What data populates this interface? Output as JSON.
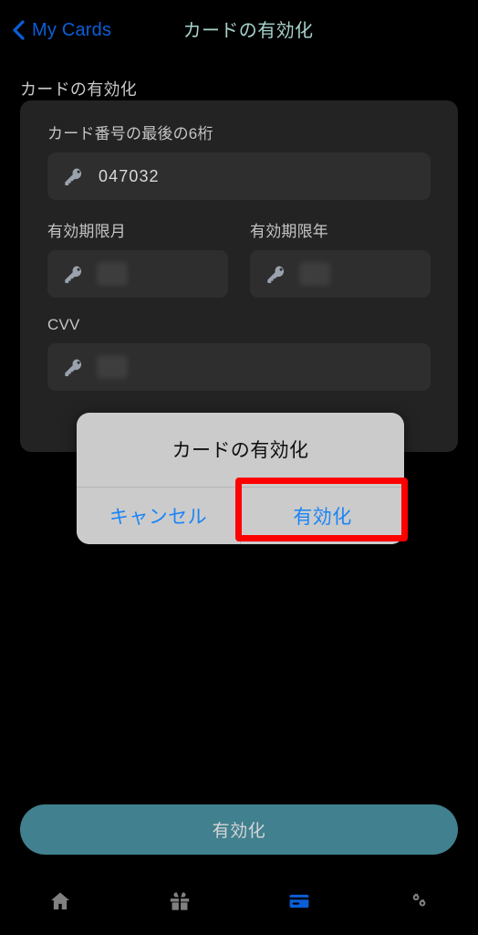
{
  "header": {
    "back_label": "My Cards",
    "back_icon": "chevron-left-icon",
    "title": "カードの有効化",
    "back_color": "#0a5fd8",
    "title_color": "#a6d2cc"
  },
  "section": {
    "heading": "カードの有効化"
  },
  "form": {
    "fields": [
      {
        "label": "カード番号の最後の6桁",
        "icon": "key-icon",
        "value": "047032",
        "obscured": false
      },
      {
        "label": "有効期限月",
        "icon": "key-icon",
        "value": "",
        "obscured": true
      },
      {
        "label": "有効期限年",
        "icon": "key-icon",
        "value": "",
        "obscured": true
      },
      {
        "label": "CVV",
        "icon": "key-icon",
        "value": "",
        "obscured": true
      }
    ]
  },
  "modal": {
    "title": "カードの有効化",
    "cancel_label": "キャンセル",
    "confirm_label": "有効化",
    "button_color": "#1a84f7",
    "background": "#cbcbcb",
    "highlight_color": "#fe0000",
    "highlighted_button": "有効化"
  },
  "cta": {
    "label": "有効化",
    "color": "#41808f",
    "text_color": "#d6d6d6"
  },
  "bottom_nav": {
    "items": [
      {
        "icon": "home-icon",
        "active": false,
        "color": "#808080"
      },
      {
        "icon": "gift-icon",
        "active": false,
        "color": "#808080"
      },
      {
        "icon": "credit-card-icon",
        "active": true,
        "color": "#0b5ed7"
      },
      {
        "icon": "settings-gears-icon",
        "active": false,
        "color": "#808080"
      }
    ]
  }
}
